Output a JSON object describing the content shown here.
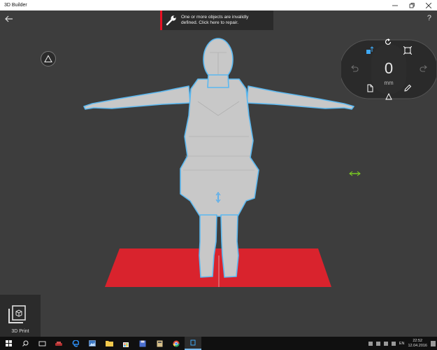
{
  "app": {
    "title": "3D Builder"
  },
  "window_controls": [
    "minimize",
    "maximize",
    "close"
  ],
  "banner": {
    "message": "One or more objects are invalidly defined. Click here to repair."
  },
  "toolbar": {
    "help": "?"
  },
  "object_ring": {
    "value": "0",
    "unit": "mm",
    "icons": [
      "rotate-icon",
      "scale-icon",
      "move-icon",
      "undo-icon",
      "redo-icon",
      "new-icon",
      "edit-icon",
      "triangle-icon"
    ]
  },
  "print": {
    "label": "3D Print"
  },
  "scene": {
    "plate_color": "#d9232d",
    "model_color": "#c8c8c8",
    "selection_color": "#5bb8f0"
  },
  "taskbar": {
    "lang": "EN",
    "time": "22:52",
    "date": "12.04.2016"
  }
}
